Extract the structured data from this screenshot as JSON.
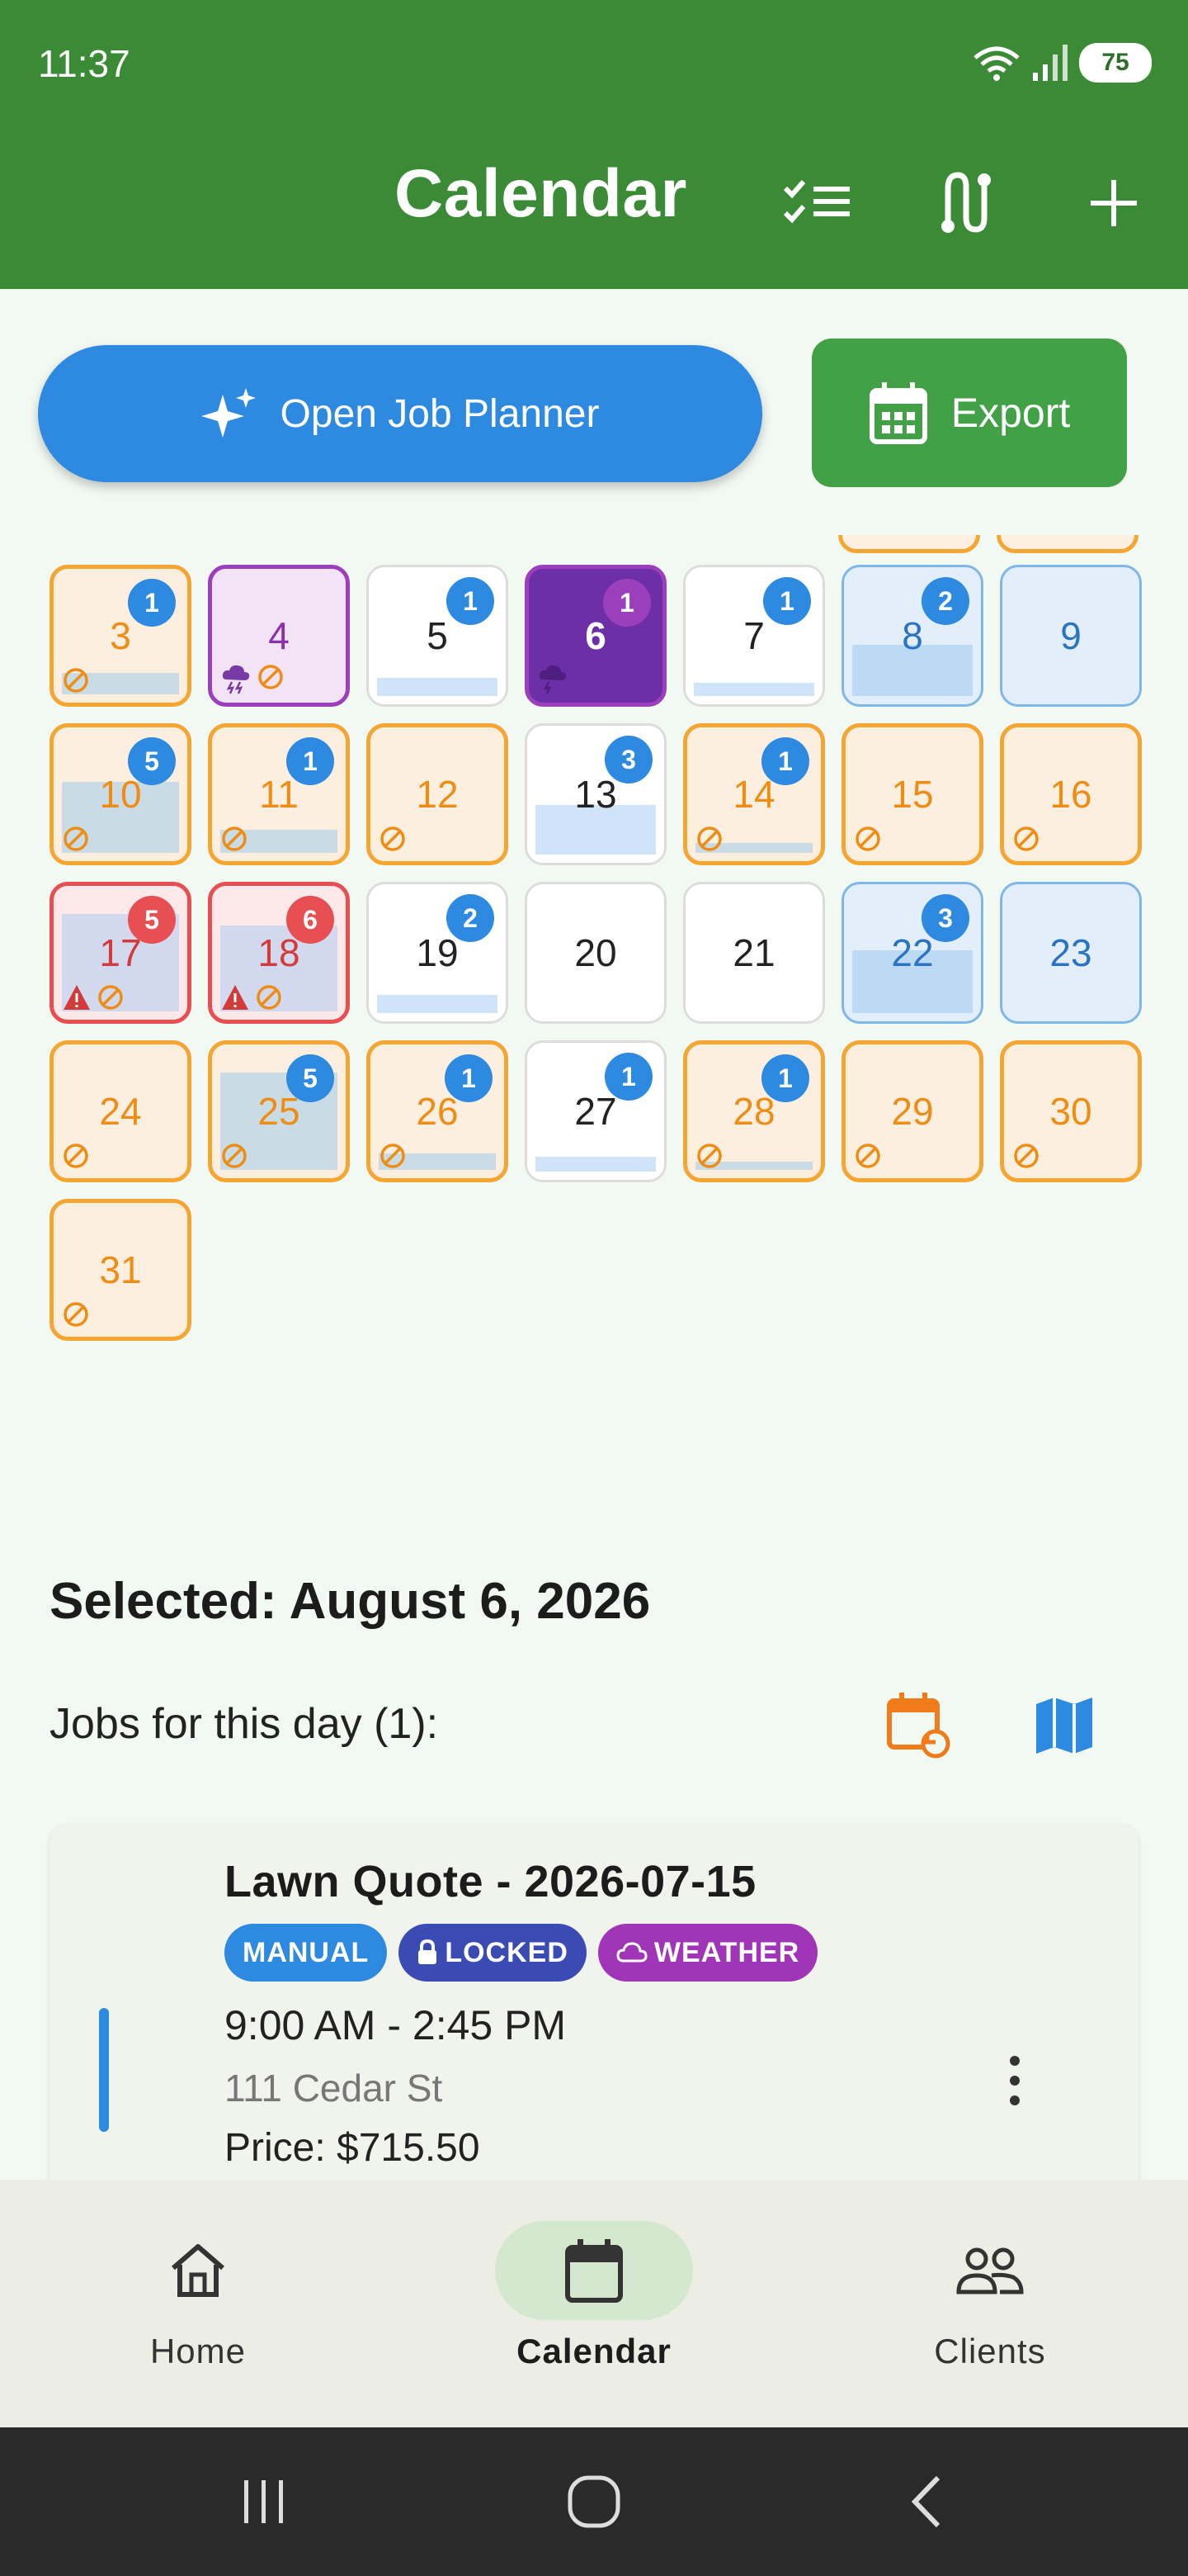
{
  "status_bar": {
    "time": "11:37",
    "battery": "75"
  },
  "app_bar": {
    "title": "Calendar"
  },
  "actions": {
    "planner_label": "Open Job Planner",
    "export_label": "Export"
  },
  "calendar": {
    "days": [
      {
        "day": "3",
        "badge": "1"
      },
      {
        "day": "4",
        "badge": ""
      },
      {
        "day": "5",
        "badge": "1"
      },
      {
        "day": "6",
        "badge": "1"
      },
      {
        "day": "7",
        "badge": "1"
      },
      {
        "day": "8",
        "badge": "2"
      },
      {
        "day": "9",
        "badge": ""
      },
      {
        "day": "10",
        "badge": "5"
      },
      {
        "day": "11",
        "badge": "1"
      },
      {
        "day": "12",
        "badge": ""
      },
      {
        "day": "13",
        "badge": "3"
      },
      {
        "day": "14",
        "badge": "1"
      },
      {
        "day": "15",
        "badge": ""
      },
      {
        "day": "16",
        "badge": ""
      },
      {
        "day": "17",
        "badge": "5"
      },
      {
        "day": "18",
        "badge": "6"
      },
      {
        "day": "19",
        "badge": "2"
      },
      {
        "day": "20",
        "badge": ""
      },
      {
        "day": "21",
        "badge": ""
      },
      {
        "day": "22",
        "badge": "3"
      },
      {
        "day": "23",
        "badge": ""
      },
      {
        "day": "24",
        "badge": ""
      },
      {
        "day": "25",
        "badge": "5"
      },
      {
        "day": "26",
        "badge": "1"
      },
      {
        "day": "27",
        "badge": "1"
      },
      {
        "day": "28",
        "badge": "1"
      },
      {
        "day": "29",
        "badge": ""
      },
      {
        "day": "30",
        "badge": ""
      },
      {
        "day": "31",
        "badge": ""
      }
    ],
    "colors": {
      "orange": "#f5a531",
      "blue": "#2e89e0",
      "red": "#e74f52",
      "purple": "#9c3fbd"
    }
  },
  "selected": {
    "title": "Selected: August 6, 2026",
    "jobs_label": "Jobs for this day (1):"
  },
  "job": {
    "title": "Lawn Quote - 2026-07-15",
    "chips": {
      "manual": "MANUAL",
      "locked": "LOCKED",
      "weather": "WEATHER"
    },
    "time": "9:00 AM - 2:45 PM",
    "address": "111 Cedar St",
    "price": "Price: $715.50"
  },
  "bottom_nav": {
    "home": "Home",
    "calendar": "Calendar",
    "clients": "Clients"
  }
}
